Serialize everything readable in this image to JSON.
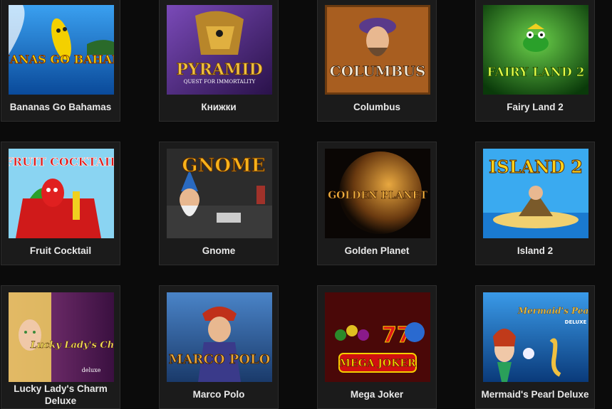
{
  "games": [
    {
      "name": "Bananas Go Bahamas",
      "logo": "BANANAS GO BAHAMAS",
      "colors": {
        "bg": "#1e78c8",
        "accent": "#f4d000"
      }
    },
    {
      "name": "Книжки",
      "logo": "PYRAMID",
      "sublogo": "QUEST FOR IMMORTALITY",
      "colors": {
        "bg": "#4b2a82",
        "accent": "#f0c040"
      }
    },
    {
      "name": "Columbus",
      "logo": "COLUMBUS",
      "colors": {
        "bg": "#b06a24",
        "accent": "#f3ead8"
      }
    },
    {
      "name": "Fairy Land 2",
      "logo": "FAIRY LAND 2",
      "colors": {
        "bg": "#1f7a1a",
        "accent": "#e8ff4a"
      }
    },
    {
      "name": "Fruit Cocktail",
      "logo": "FRUIT COCKTAIL",
      "colors": {
        "bg": "#7fd0f0",
        "accent": "#e01818"
      }
    },
    {
      "name": "Gnome",
      "logo": "GNOME",
      "colors": {
        "bg": "#2a2a2a",
        "accent": "#f6b21b"
      }
    },
    {
      "name": "Golden Planet",
      "logo": "GOLDEN PLANET",
      "colors": {
        "bg": "#120a04",
        "accent": "#d8962a"
      }
    },
    {
      "name": "Island 2",
      "logo": "ISLAND 2",
      "colors": {
        "bg": "#35a8e8",
        "accent": "#ffd21a"
      }
    },
    {
      "name": "Lucky Lady's Charm Deluxe",
      "logo": "Lucky Lady's Charm",
      "sublogo": "deluxe",
      "colors": {
        "bg": "#5a2060",
        "accent": "#f7e25a"
      }
    },
    {
      "name": "Marco Polo",
      "logo": "MARCO POLO",
      "colors": {
        "bg": "#2e5e9c",
        "accent": "#e8a838"
      }
    },
    {
      "name": "Mega Joker",
      "logo": "MEGA JOKER",
      "colors": {
        "bg": "#5a0a0a",
        "accent": "#f5d000"
      }
    },
    {
      "name": "Mermaid's Pearl Deluxe",
      "logo": "Mermaid's Pearl",
      "sublogo": "DELUXE",
      "colors": {
        "bg": "#1a6cc0",
        "accent": "#f0c040"
      }
    }
  ]
}
